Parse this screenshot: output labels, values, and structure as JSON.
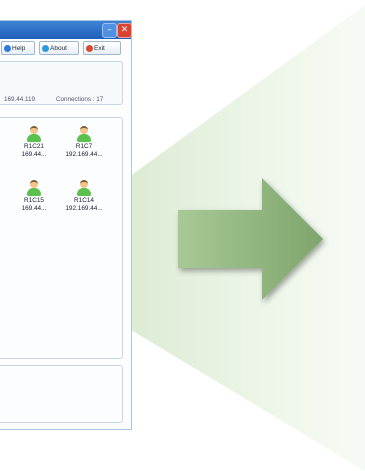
{
  "toolbar": {
    "help_label": "Help",
    "about_label": "About",
    "exit_label": "Exit"
  },
  "status": {
    "ip_text": "169.44.119",
    "connections_text": "Connections : 17"
  },
  "clients": [
    {
      "name": "R1C21",
      "ip": "169.44..."
    },
    {
      "name": "R1C7",
      "ip": "192.169.44..."
    },
    {
      "name": "R1C15",
      "ip": "169.44..."
    },
    {
      "name": "R1C14",
      "ip": "192.169.44..."
    }
  ],
  "colors": {
    "titlebar": "#2c6fc8",
    "arrow": "#8fb47b",
    "cone": "#d7e6cc"
  },
  "icons": {
    "help": "help-icon",
    "about": "info-icon",
    "exit": "exit-icon",
    "user": "user-icon",
    "arrow": "right-arrow-icon"
  }
}
